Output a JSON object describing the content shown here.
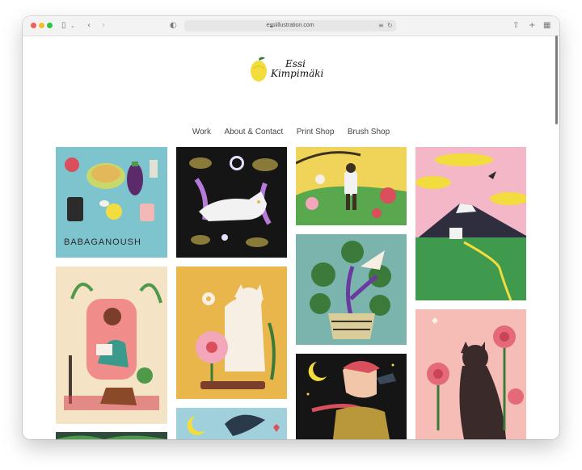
{
  "browser": {
    "url": "essiillustration.com",
    "controls": {
      "sidebar_icon": "sidebar-icon",
      "back_icon": "back-icon",
      "forward_icon": "forward-icon",
      "privacy_icon": "shield-icon",
      "reader_icon": "reader-icon",
      "reload_icon": "reload-icon",
      "share_icon": "share-icon",
      "new_tab_icon": "plus-icon",
      "tabs_icon": "tabs-overview-icon"
    }
  },
  "site": {
    "logo_line1": "Essi",
    "logo_line2": "Kimpimäki",
    "nav": [
      "Work",
      "About & Contact",
      "Print Shop",
      "Brush Shop"
    ]
  },
  "gallery": {
    "tiles": [
      {
        "name": "babaganoush",
        "text": "BABAGANOUSH"
      },
      {
        "name": "white-cat-night"
      },
      {
        "name": "garden-walker"
      },
      {
        "name": "mountain-house"
      },
      {
        "name": "plant-pot"
      },
      {
        "name": "armchair-reader"
      },
      {
        "name": "cat-flowers"
      },
      {
        "name": "moon-woman"
      },
      {
        "name": "black-cat-roses"
      },
      {
        "name": "moon-partial"
      },
      {
        "name": "green-partial"
      }
    ]
  },
  "colors": {
    "accent_yellow": "#e8b64a",
    "blue": "#7ec4cf",
    "pink": "#f3b7b5",
    "dark": "#151515",
    "green": "#4f9a4a"
  }
}
